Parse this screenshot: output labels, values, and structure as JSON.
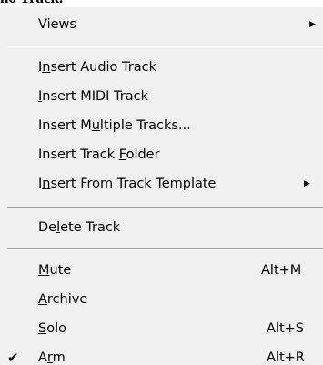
{
  "caption": "lio Track.",
  "menu": {
    "items": [
      {
        "label_pre": "Views",
        "u": "",
        "label_post": "",
        "shortcut": "",
        "submenu": true
      },
      {
        "label_pre": "I",
        "u": "n",
        "label_post": "sert Audio Track",
        "shortcut": "",
        "submenu": false
      },
      {
        "label_pre": "",
        "u": "I",
        "label_post": "nsert MIDI Track",
        "shortcut": "",
        "submenu": false
      },
      {
        "label_pre": "Insert M",
        "u": "u",
        "label_post": "ltiple Tracks...",
        "shortcut": "",
        "submenu": false
      },
      {
        "label_pre": "Insert Track ",
        "u": "F",
        "label_post": "older",
        "shortcut": "",
        "submenu": false
      },
      {
        "label_pre": "I",
        "u": "n",
        "label_post": "sert From Track Template",
        "shortcut": "",
        "submenu": true
      },
      {
        "label_pre": "De",
        "u": "l",
        "label_post": "ete Track",
        "shortcut": "",
        "submenu": false
      },
      {
        "label_pre": "",
        "u": "M",
        "label_post": "ute",
        "shortcut": "Alt+M",
        "submenu": false
      },
      {
        "label_pre": "",
        "u": "A",
        "label_post": "rchive",
        "shortcut": "",
        "submenu": false
      },
      {
        "label_pre": "",
        "u": "S",
        "label_post": "olo",
        "shortcut": "Alt+S",
        "submenu": false
      },
      {
        "label_pre": "A",
        "u": "r",
        "label_post": "m",
        "shortcut": "Alt+R",
        "submenu": false,
        "checked": true
      }
    ],
    "submenu_arrow": "▶",
    "check_mark": "✔"
  }
}
